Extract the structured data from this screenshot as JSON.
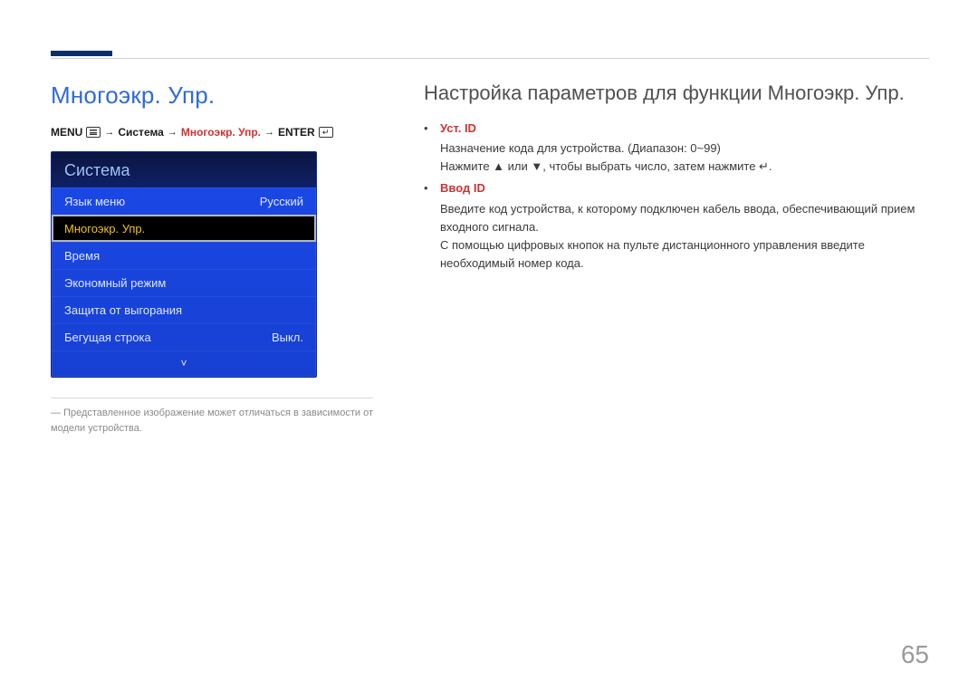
{
  "page_number": "65",
  "left": {
    "title": "Многоэкр. Упр.",
    "breadcrumb": {
      "menu": "MENU",
      "step1": "Система",
      "step2": "Многоэкр. Упр.",
      "enter": "ENTER"
    },
    "osd": {
      "header": "Система",
      "rows": [
        {
          "label": "Язык меню",
          "value": "Русский",
          "selected": false
        },
        {
          "label": "Многоэкр. Упр.",
          "value": "",
          "selected": true
        },
        {
          "label": "Время",
          "value": "",
          "selected": false
        },
        {
          "label": "Экономный режим",
          "value": "",
          "selected": false
        },
        {
          "label": "Защита от выгорания",
          "value": "",
          "selected": false
        },
        {
          "label": "Бегущая строка",
          "value": "Выкл.",
          "selected": false
        }
      ],
      "more_indicator": "˅"
    },
    "caption_prefix": "― ",
    "caption": "Представленное изображение может отличаться в зависимости от модели устройства."
  },
  "right": {
    "title": "Настройка параметров для функции Многоэкр. Упр.",
    "items": [
      {
        "head": "Уст. ID",
        "lines": [
          "Назначение кода для устройства. (Диапазон: 0~99)",
          "Нажмите ▲ или ▼, чтобы выбрать число, затем нажмите ↵."
        ]
      },
      {
        "head": "Ввод ID",
        "lines": [
          "Введите код устройства, к которому подключен кабель ввода, обеспечивающий прием входного сигнала.",
          "С помощью цифровых кнопок на пульте дистанционного управления введите необходимый номер кода."
        ]
      }
    ]
  }
}
